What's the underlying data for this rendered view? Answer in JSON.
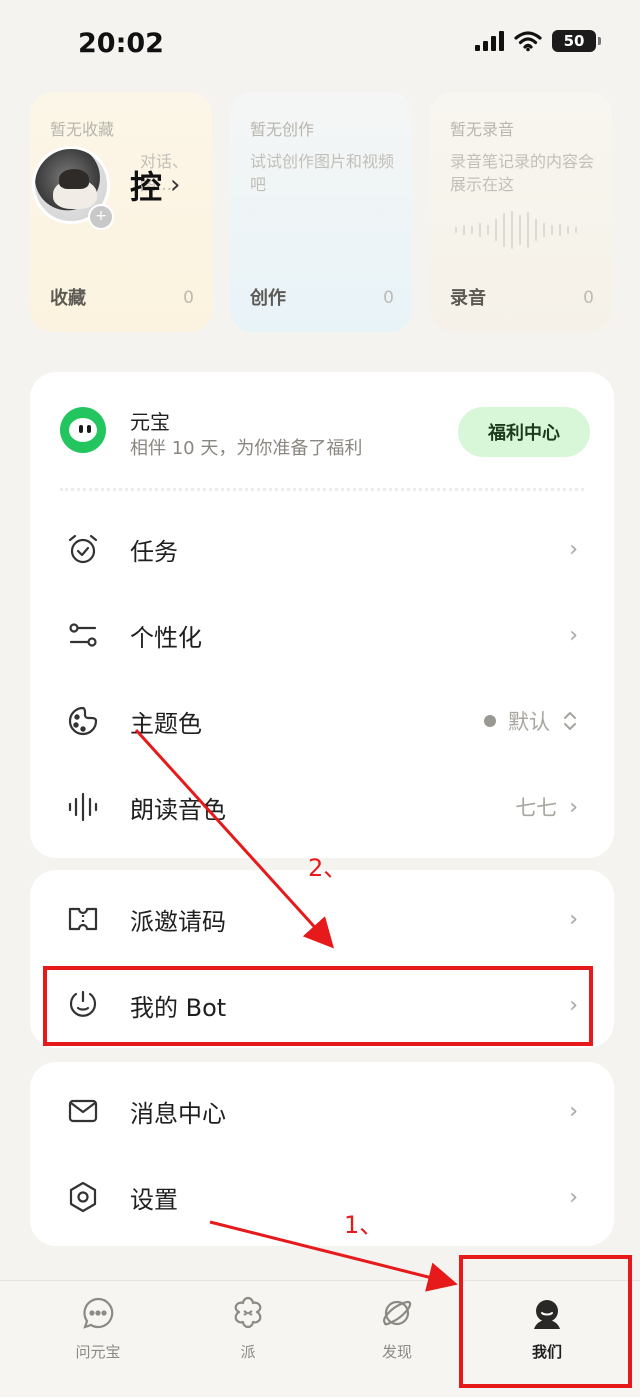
{
  "status": {
    "time": "20:02",
    "battery": "50"
  },
  "cards": [
    {
      "empty": "暂无收藏",
      "desc": "对话、图…",
      "label": "收藏",
      "count": "0"
    },
    {
      "empty": "暂无创作",
      "desc": "试试创作图片和视频吧",
      "label": "创作",
      "count": "0"
    },
    {
      "empty": "暂无录音",
      "desc": "录音笔记录的内容会展示在这",
      "label": "录音",
      "count": "0"
    }
  ],
  "profile": {
    "name": "控",
    "chevron": "›"
  },
  "yuanbao": {
    "title": "元宝",
    "subtitle": "相伴 10 天，为你准备了福利",
    "button": "福利中心"
  },
  "menu_group1": [
    {
      "label": "任务",
      "icon": "alarm-clock-icon",
      "value": ""
    },
    {
      "label": "个性化",
      "icon": "sliders-icon",
      "value": ""
    },
    {
      "label": "主题色",
      "icon": "palette-icon",
      "value": "默认"
    },
    {
      "label": "朗读音色",
      "icon": "waveform-icon",
      "value": "七七"
    }
  ],
  "menu_group2": [
    {
      "label": "派邀请码",
      "icon": "ticket-icon"
    },
    {
      "label": "我的 Bot",
      "icon": "bot-icon"
    }
  ],
  "menu_group3": [
    {
      "label": "消息中心",
      "icon": "mail-icon"
    },
    {
      "label": "设置",
      "icon": "settings-hex-icon"
    }
  ],
  "tabs": [
    {
      "label": "问元宝",
      "icon": "chat-bubble-icon"
    },
    {
      "label": "派",
      "icon": "flower-icon"
    },
    {
      "label": "发现",
      "icon": "planet-icon"
    },
    {
      "label": "我们",
      "icon": "person-icon"
    }
  ],
  "annotations": {
    "step1": "1、",
    "step2": "2、"
  },
  "colors": {
    "accent_green": "#22c55e",
    "annotation_red": "#e61a1a",
    "button_bg": "#d8f7d8"
  }
}
